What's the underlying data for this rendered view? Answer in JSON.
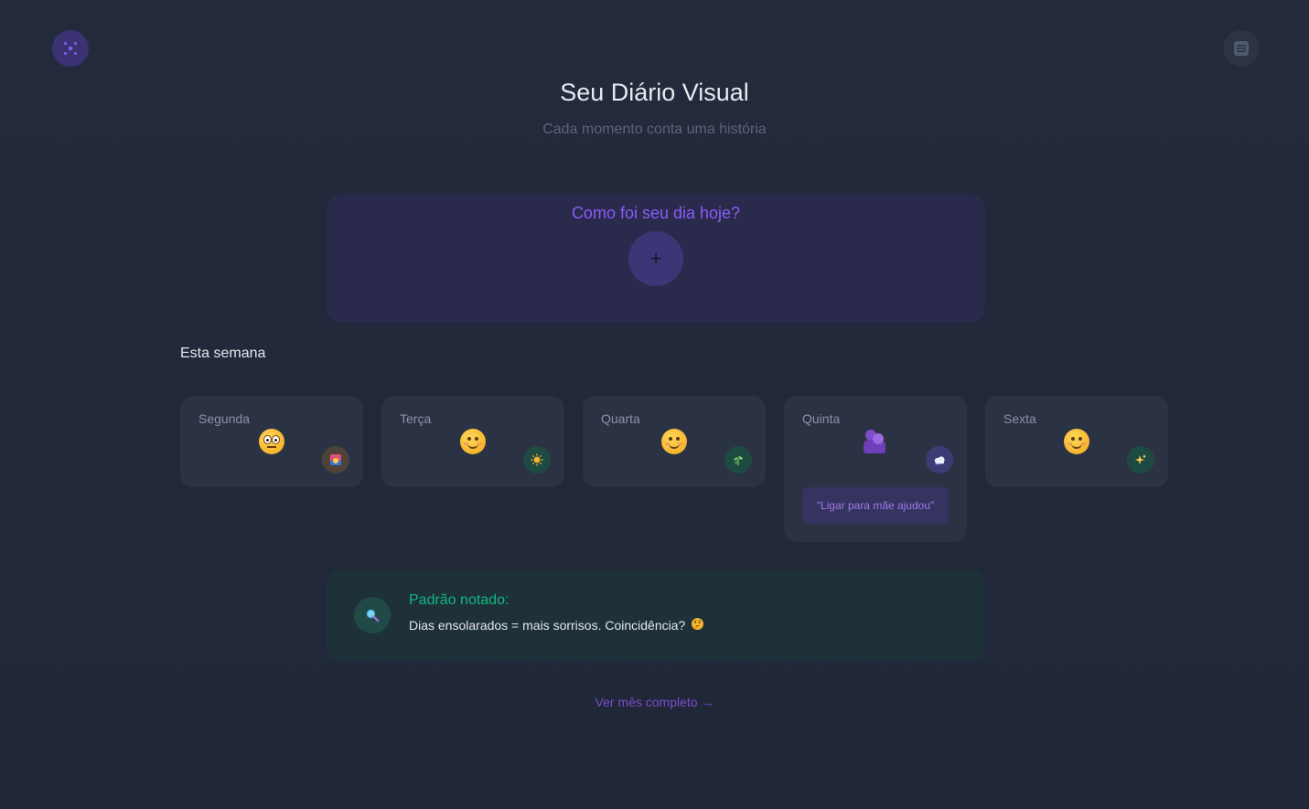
{
  "header": {
    "title": "Seu Diário Visual",
    "subtitle": "Cada momento conta uma história",
    "logo_icon": "dots-logo-icon",
    "menu_icon": "menu-icon"
  },
  "checkin": {
    "question": "Como foi seu dia hoje?",
    "add_label": "+"
  },
  "week": {
    "label": "Esta semana",
    "days": [
      {
        "name": "Segunda",
        "mood": "neutral-face",
        "weather": "sunset-icon"
      },
      {
        "name": "Terça",
        "mood": "smiling-face",
        "weather": "sun-icon"
      },
      {
        "name": "Quarta",
        "mood": "smiling-face",
        "weather": "herb-icon"
      },
      {
        "name": "Quinta",
        "mood": "hug-icon",
        "weather": "cloud-icon",
        "note": "\"Ligar para mãe ajudou\""
      },
      {
        "name": "Sexta",
        "mood": "smiling-face",
        "weather": "sparkles-icon"
      }
    ]
  },
  "insight": {
    "title": "Padrão notado:",
    "text": "Dias ensolarados = mais sorrisos. Coincidência?",
    "icon": "magnifier-icon",
    "emoji": "thinking-face-icon"
  },
  "footer": {
    "link": "Ver mês completo →"
  },
  "colors": {
    "accent": "#8b5cf6",
    "insight_green": "#10b981",
    "background": "#222a3c"
  }
}
